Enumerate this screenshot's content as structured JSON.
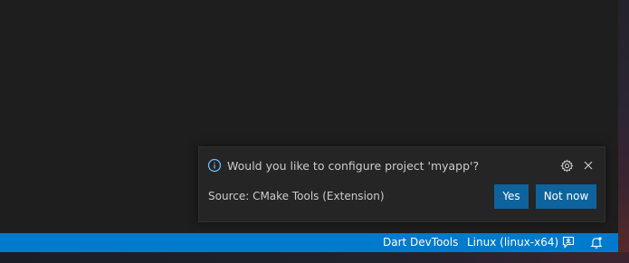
{
  "notification": {
    "message": "Would you like to configure project 'myapp'?",
    "source": "Source: CMake Tools (Extension)",
    "buttons": {
      "primary": "Yes",
      "secondary": "Not now"
    },
    "icons": {
      "info": "info-icon",
      "settings": "gear-icon",
      "close": "close-icon"
    }
  },
  "statusbar": {
    "items": [
      {
        "label": "Dart DevTools"
      },
      {
        "label": "Linux (linux-x64)"
      }
    ],
    "icons": {
      "feedback": "feedback-icon",
      "notifications": "bell-icon"
    }
  },
  "colors": {
    "statusbar_bg": "#007acc",
    "button_bg": "#0e639c",
    "toast_bg": "#252526",
    "editor_bg": "#1e1e1e",
    "info_icon": "#75beff"
  }
}
